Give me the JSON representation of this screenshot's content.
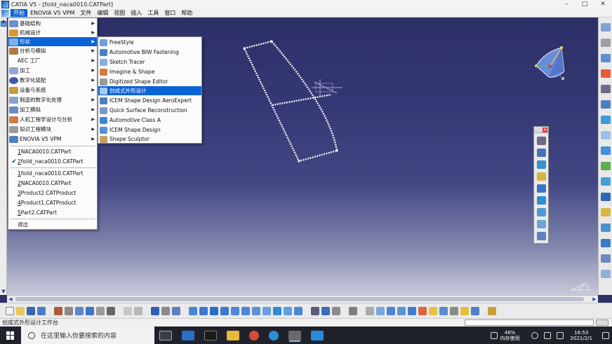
{
  "window": {
    "title": "CATIA V5 - [foild_naca0010.CATPart]",
    "controls": [
      "–",
      "□",
      "✕"
    ]
  },
  "menubar": {
    "items": [
      "开始",
      "ENOVIA V5 VPM",
      "文件",
      "编辑",
      "视图",
      "插入",
      "工具",
      "窗口",
      "帮助"
    ],
    "active_index": 0
  },
  "start_menu": {
    "items": [
      {
        "label": "基础结构",
        "submenu": true,
        "icon": "infrastructure-icon"
      },
      {
        "label": "机械设计",
        "submenu": true,
        "icon": "mechanical-design-icon"
      },
      {
        "label": "形状",
        "submenu": true,
        "icon": "shape-icon",
        "highlighted": true
      },
      {
        "label": "分析与模拟",
        "submenu": true,
        "icon": "analysis-icon"
      },
      {
        "label": "AEC 工厂",
        "submenu": true,
        "icon": "aec-plant-icon"
      },
      {
        "label": "加工",
        "submenu": true,
        "icon": "machining-icon"
      },
      {
        "label": "数字化装配",
        "submenu": true,
        "icon": "digital-mockup-icon"
      },
      {
        "label": "设备与系统",
        "submenu": true,
        "icon": "equipment-icon"
      },
      {
        "label": "制造的数字化处理",
        "submenu": true,
        "icon": "manufacturing-icon"
      },
      {
        "label": "加工模拟",
        "submenu": true,
        "icon": "machining-sim-icon"
      },
      {
        "label": "人机工程学设计与分析",
        "submenu": true,
        "icon": "ergonomics-icon"
      },
      {
        "label": "知识工程模块",
        "submenu": true,
        "icon": "knowledgeware-icon"
      },
      {
        "label": "ENOVIA V5 VPM",
        "submenu": true,
        "icon": "enovia-icon"
      }
    ],
    "recent_workbench": [
      {
        "number": "1",
        "label": " NACA0010.CATPart"
      },
      {
        "number": "2",
        "label": " foild_naca0010.CATPart",
        "checked": true
      }
    ],
    "recent_files": [
      {
        "number": "1",
        "label": " foild_naca0010.CATPart"
      },
      {
        "number": "2",
        "label": " NACA0010.CATPart"
      },
      {
        "number": "3",
        "label": " Product2.CATProduct"
      },
      {
        "number": "4",
        "label": " Product1.CATProduct"
      },
      {
        "number": "5",
        "label": " Part2.CATPart"
      }
    ],
    "exit_label": "退出"
  },
  "shape_submenu": {
    "items": [
      {
        "label": "FreeStyle",
        "icon": "freestyle-icon"
      },
      {
        "label": "Automotive BIW Fastening",
        "icon": "biw-fastening-icon"
      },
      {
        "label": "Sketch Tracer",
        "icon": "sketch-tracer-icon"
      },
      {
        "label": "Imagine & Shape",
        "icon": "imagine-shape-icon"
      },
      {
        "label": "Digitized Shape Editor",
        "icon": "digitized-shape-icon"
      },
      {
        "label": "创成式外形设计",
        "icon": "gsd-icon",
        "highlighted": true
      },
      {
        "label": "ICEM Shape Design AeroExpert",
        "icon": "icem-aero-icon"
      },
      {
        "label": "Quick Surface Reconstruction",
        "icon": "qsr-icon"
      },
      {
        "label": "Automotive Class A",
        "icon": "class-a-icon"
      },
      {
        "label": "ICEM Shape Design",
        "icon": "icem-shape-icon"
      },
      {
        "label": "Shape Sculptor",
        "icon": "shape-sculptor-icon"
      }
    ]
  },
  "status": {
    "text": "创成式外形设计工作台"
  },
  "taskbar": {
    "search_placeholder": "在这里输入你要搜索的内容",
    "memory_percent": "46%",
    "memory_label": "内存使用",
    "time": "16:53",
    "date": "2021/2/1"
  },
  "colors": {
    "highlight": "#0a64d6",
    "viewport_top": "#2d3067",
    "viewport_bottom": "#c8cad9"
  }
}
